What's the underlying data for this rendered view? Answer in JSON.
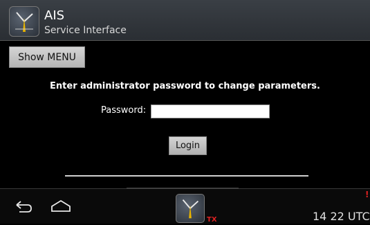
{
  "header": {
    "title": "AIS",
    "subtitle": "Service Interface"
  },
  "toolbar": {
    "menu_label": "Show MENU"
  },
  "login": {
    "instruction": "Enter administrator password to change parameters.",
    "password_label": "Password:",
    "password_value": "",
    "login_label": "Login"
  },
  "navbar": {
    "tx_label": "TX",
    "alert": "!",
    "clock": "14 22 UTC"
  },
  "icons": {
    "app": "ais-radar-icon",
    "back": "back-arrow-icon",
    "home": "home-icon",
    "tray": "ais-radar-icon"
  },
  "colors": {
    "tx": "#dd2222",
    "background": "#000000"
  }
}
